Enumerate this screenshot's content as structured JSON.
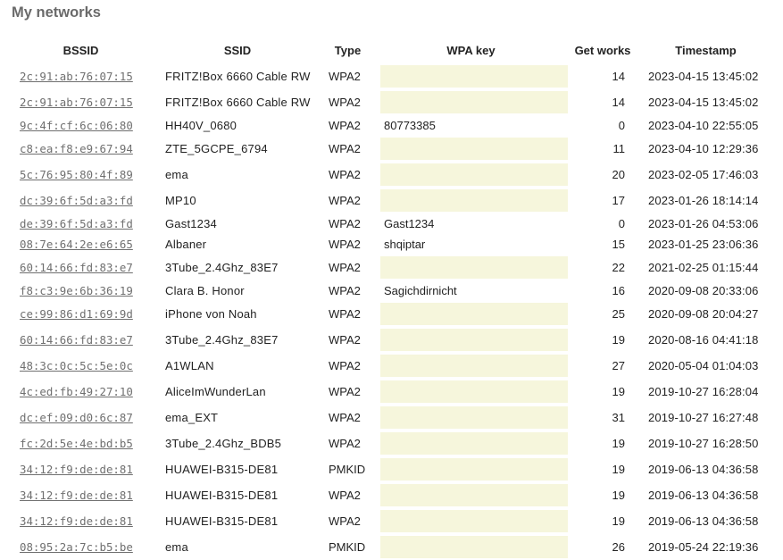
{
  "page": {
    "title": "My networks"
  },
  "colors": {
    "key_input_background": "#f6f6dc",
    "link": "#6f6f6f",
    "title": "#6a6a6a"
  },
  "table": {
    "headers": {
      "bssid": "BSSID",
      "ssid": "SSID",
      "type": "Type",
      "wpa_key": "WPA key",
      "get_works": "Get works",
      "timestamp": "Timestamp"
    },
    "rows": [
      {
        "bssid": "2c:91:ab:76:07:15",
        "ssid": "FRITZ!Box 6660 Cable RW",
        "type": "WPA2",
        "key": "",
        "works": "14",
        "timestamp": "2023-04-15 13:45:02"
      },
      {
        "bssid": "2c:91:ab:76:07:15",
        "ssid": "FRITZ!Box 6660 Cable RW",
        "type": "WPA2",
        "key": "",
        "works": "14",
        "timestamp": "2023-04-15 13:45:02"
      },
      {
        "bssid": "9c:4f:cf:6c:06:80",
        "ssid": "HH40V_0680",
        "type": "WPA2",
        "key": "80773385",
        "works": "0",
        "timestamp": "2023-04-10 22:55:05"
      },
      {
        "bssid": "c8:ea:f8:e9:67:94",
        "ssid": "ZTE_5GCPE_6794",
        "type": "WPA2",
        "key": "",
        "works": "11",
        "timestamp": "2023-04-10 12:29:36"
      },
      {
        "bssid": "5c:76:95:80:4f:89",
        "ssid": "ema",
        "type": "WPA2",
        "key": "",
        "works": "20",
        "timestamp": "2023-02-05 17:46:03"
      },
      {
        "bssid": "dc:39:6f:5d:a3:fd",
        "ssid": "MP10",
        "type": "WPA2",
        "key": "",
        "works": "17",
        "timestamp": "2023-01-26 18:14:14"
      },
      {
        "bssid": "de:39:6f:5d:a3:fd",
        "ssid": "Gast1234",
        "type": "WPA2",
        "key": "Gast1234",
        "works": "0",
        "timestamp": "2023-01-26 04:53:06"
      },
      {
        "bssid": "08:7e:64:2e:e6:65",
        "ssid": "Albaner",
        "type": "WPA2",
        "key": "shqiptar",
        "works": "15",
        "timestamp": "2023-01-25 23:06:36"
      },
      {
        "bssid": "60:14:66:fd:83:e7",
        "ssid": "3Tube_2.4Ghz_83E7",
        "type": "WPA2",
        "key": "",
        "works": "22",
        "timestamp": "2021-02-25 01:15:44"
      },
      {
        "bssid": "f8:c3:9e:6b:36:19",
        "ssid": "Clara B. Honor",
        "type": "WPA2",
        "key": "Sagichdirnicht",
        "works": "16",
        "timestamp": "2020-09-08 20:33:06"
      },
      {
        "bssid": "ce:99:86:d1:69:9d",
        "ssid": "iPhone von Noah",
        "type": "WPA2",
        "key": "",
        "works": "25",
        "timestamp": "2020-09-08 20:04:27"
      },
      {
        "bssid": "60:14:66:fd:83:e7",
        "ssid": "3Tube_2.4Ghz_83E7",
        "type": "WPA2",
        "key": "",
        "works": "19",
        "timestamp": "2020-08-16 04:41:18"
      },
      {
        "bssid": "48:3c:0c:5c:5e:0c",
        "ssid": "A1WLAN",
        "type": "WPA2",
        "key": "",
        "works": "27",
        "timestamp": "2020-05-04 01:04:03"
      },
      {
        "bssid": "4c:ed:fb:49:27:10",
        "ssid": "AliceImWunderLan",
        "type": "WPA2",
        "key": "",
        "works": "19",
        "timestamp": "2019-10-27 16:28:04"
      },
      {
        "bssid": "dc:ef:09:d0:6c:87",
        "ssid": "ema_EXT",
        "type": "WPA2",
        "key": "",
        "works": "31",
        "timestamp": "2019-10-27 16:27:48"
      },
      {
        "bssid": "fc:2d:5e:4e:bd:b5",
        "ssid": "3Tube_2.4Ghz_BDB5",
        "type": "WPA2",
        "key": "",
        "works": "19",
        "timestamp": "2019-10-27 16:28:50"
      },
      {
        "bssid": "34:12:f9:de:de:81",
        "ssid": "HUAWEI-B315-DE81",
        "type": "PMKID",
        "key": "",
        "works": "19",
        "timestamp": "2019-06-13 04:36:58"
      },
      {
        "bssid": "34:12:f9:de:de:81",
        "ssid": "HUAWEI-B315-DE81",
        "type": "WPA2",
        "key": "",
        "works": "19",
        "timestamp": "2019-06-13 04:36:58"
      },
      {
        "bssid": "34:12:f9:de:de:81",
        "ssid": "HUAWEI-B315-DE81",
        "type": "WPA2",
        "key": "",
        "works": "19",
        "timestamp": "2019-06-13 04:36:58"
      },
      {
        "bssid": "08:95:2a:7c:b5:be",
        "ssid": "ema",
        "type": "PMKID",
        "key": "",
        "works": "26",
        "timestamp": "2019-05-24 22:19:36"
      }
    ]
  }
}
